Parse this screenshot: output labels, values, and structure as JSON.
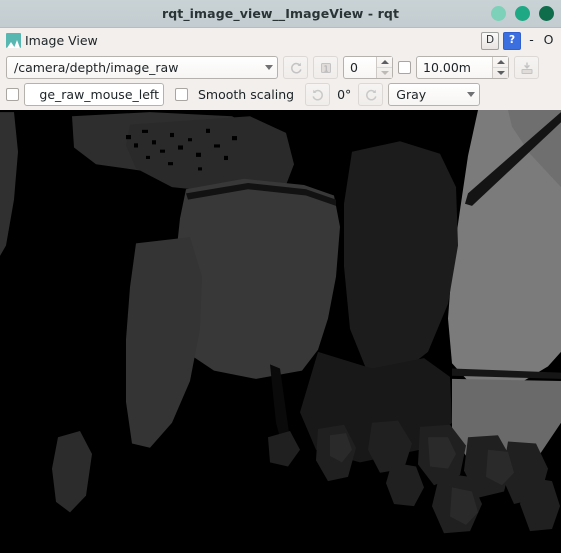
{
  "window": {
    "title": "rqt_image_view__ImageView - rqt",
    "buttons": [
      {
        "name": "minimize",
        "color": "#7dd1b8"
      },
      {
        "name": "maximize",
        "color": "#1ea884"
      },
      {
        "name": "close",
        "color": "#0f6d4c"
      }
    ]
  },
  "plugin": {
    "icon": "image-view-icon",
    "title": "Image View",
    "dock_button_label": "D",
    "help_button_label": "?",
    "minimize_label": "-",
    "close_label": "O"
  },
  "toolbar_row1": {
    "topic_value": "/camera/depth/image_raw",
    "refresh_icon": "refresh-icon",
    "publish_button_label": "1",
    "index_value": "0",
    "dynamic_range_checkbox_checked": false,
    "max_range_value": "10.00m",
    "save_icon": "save-image-icon"
  },
  "toolbar_row2": {
    "publish_click_checkbox_checked": false,
    "click_topic_value": "ge_raw_mouse_left",
    "smooth_scaling_label": "Smooth scaling",
    "smooth_scaling_checked": false,
    "rotate_left_icon": "rotate-left-icon",
    "rotation_value": "0°",
    "rotate_right_icon": "rotate-right-icon",
    "colormap_value": "Gray"
  },
  "image": {
    "name": "depth-image-canvas",
    "background": "#000000",
    "palette": {
      "black": "#000000",
      "near_black": "#0c0c0c",
      "dark_gray": "#1d1d1d",
      "mid_dark": "#2b2b2b",
      "mid_gray": "#3a3a3a",
      "gray": "#4b4b4b",
      "light_gray": "#6d6d6d",
      "lighter_gray": "#7c7c7c"
    }
  },
  "colors": {
    "titlebar_bg": "#c5cfd3",
    "panel_bg": "#f2efed",
    "accent_blue": "#3b6fe0",
    "plugin_icon_teal": "#58b7b0"
  }
}
